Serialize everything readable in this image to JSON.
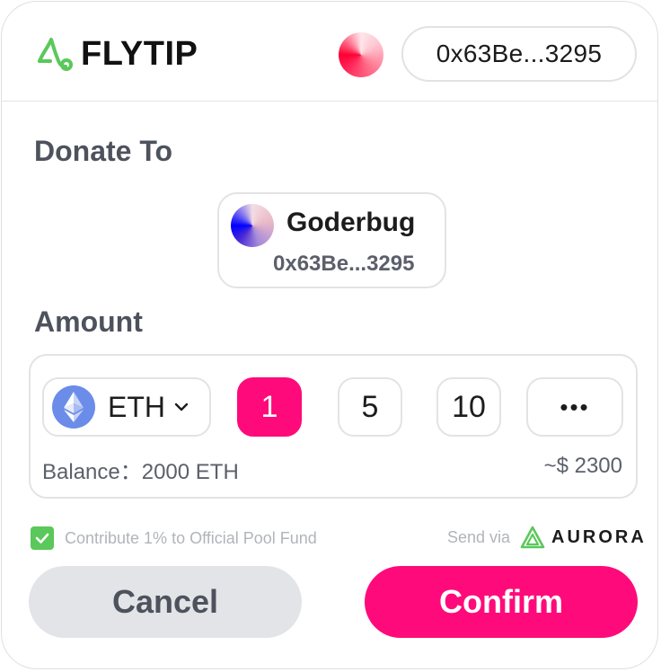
{
  "header": {
    "brand": "FLYTIP",
    "wallet_address": "0x63Be...3295"
  },
  "donate": {
    "title": "Donate To",
    "recipient_name": "Goderbug",
    "recipient_address": "0x63Be...3295"
  },
  "amount": {
    "title": "Amount",
    "token": "ETH",
    "presets": [
      "1",
      "5",
      "10"
    ],
    "selected_preset": "1",
    "more_label": "•••",
    "balance": "Balance：2000 ETH",
    "usd_value": "~$ 2300"
  },
  "footer": {
    "contribute_label": "Contribute 1% to Official Pool Fund",
    "contribute_checked": true,
    "send_via_label": "Send via",
    "network_name": "AURORA"
  },
  "actions": {
    "cancel_label": "Cancel",
    "confirm_label": "Confirm"
  },
  "colors": {
    "accent": "#ff0a7a",
    "logo_green": "#5ac85a",
    "text_muted": "#5b606a"
  }
}
